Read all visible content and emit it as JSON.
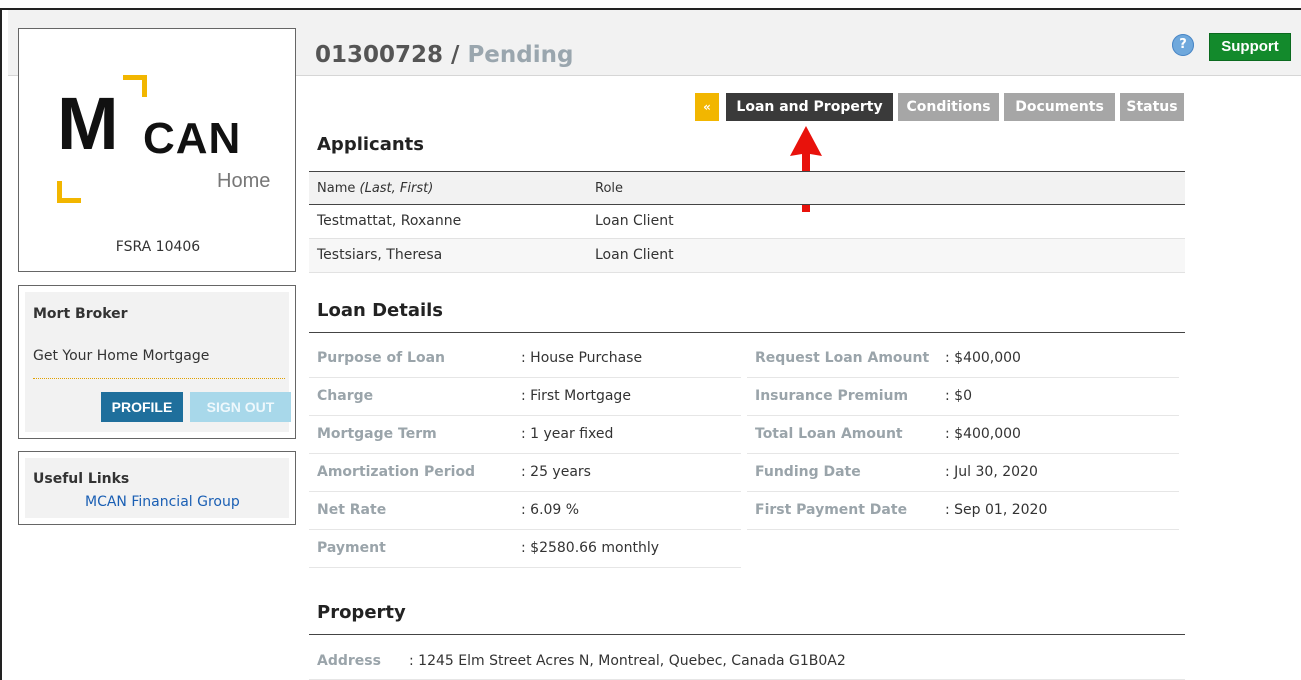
{
  "header": {
    "loan_number": "01300728",
    "separator": " / ",
    "status": "Pending",
    "help_icon": "question-icon",
    "support_label": "Support"
  },
  "logo": {
    "m": "M",
    "can": "CAN",
    "home": "Home",
    "brand_color": "#f2b600",
    "license": "FSRA 10406"
  },
  "broker": {
    "name": "Mort Broker",
    "company": "Get Your Home Mortgage",
    "profile_label": "PROFILE",
    "signout_label": "SIGN OUT"
  },
  "useful_links": {
    "title": "Useful Links",
    "items": [
      "MCAN Financial Group"
    ]
  },
  "tabs": {
    "collapse_label": "«",
    "items": [
      "Loan and Property",
      "Conditions",
      "Documents",
      "Status"
    ],
    "active": "Loan and Property"
  },
  "applicants": {
    "heading": "Applicants",
    "col_name": "Name ",
    "col_name_hint": "(Last, First)",
    "col_role": "Role",
    "rows": [
      {
        "name": "Testmattat, Roxanne",
        "role": "Loan Client"
      },
      {
        "name": "Testsiars, Theresa",
        "role": "Loan Client"
      }
    ]
  },
  "loan_details": {
    "heading": "Loan Details",
    "left": [
      {
        "label": "Purpose of Loan",
        "value": ": House Purchase"
      },
      {
        "label": "Charge",
        "value": ": First Mortgage"
      },
      {
        "label": "Mortgage Term",
        "value": ": 1 year fixed"
      },
      {
        "label": "Amortization Period",
        "value": ": 25 years"
      },
      {
        "label": "Net Rate",
        "value": ": 6.09 %"
      },
      {
        "label": "Payment",
        "value": ": $2580.66 monthly"
      }
    ],
    "right": [
      {
        "label": "Request Loan Amount",
        "value": ": $400,000"
      },
      {
        "label": "Insurance Premium",
        "value": ": $0"
      },
      {
        "label": "Total Loan Amount",
        "value": ": $400,000"
      },
      {
        "label": "Funding Date",
        "value": ": Jul 30, 2020"
      },
      {
        "label": "First Payment Date",
        "value": ": Sep 01, 2020"
      }
    ]
  },
  "property": {
    "heading": "Property",
    "address_label": "Address",
    "address_value": ": 1245 Elm Street Acres N, Montreal, Quebec, Canada G1B0A2"
  },
  "colors": {
    "active_tab": "#3a3a3a",
    "inactive_tab": "#a6a6a6",
    "support": "#138a2c",
    "profile": "#1f6f9c",
    "signout": "#a8d8ea",
    "annotation_arrow": "#e8120c"
  }
}
